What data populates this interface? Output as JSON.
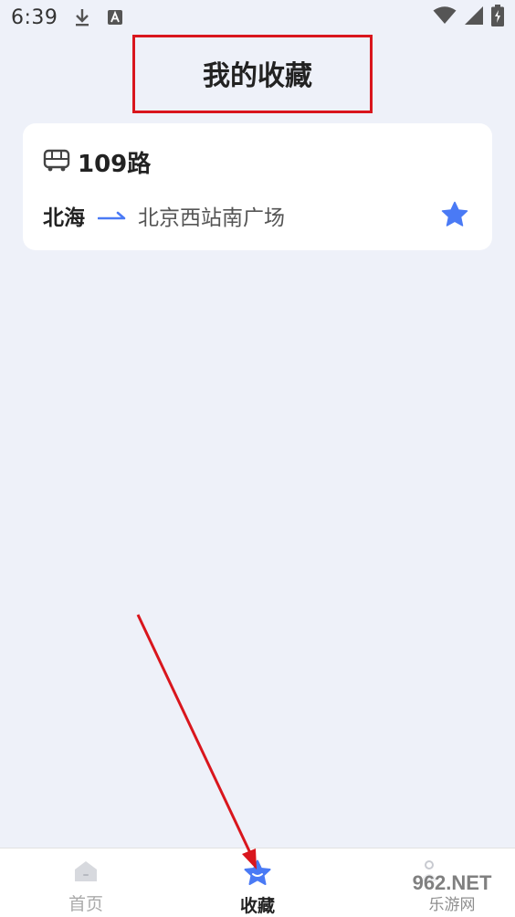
{
  "status_bar": {
    "time": "6:39"
  },
  "header": {
    "title": "我的收藏"
  },
  "favorites": [
    {
      "route": "109路",
      "from": "北海",
      "to": "北京西站南广场"
    }
  ],
  "bottom_nav": {
    "home_label": "首页",
    "favorites_label": "收藏"
  },
  "colors": {
    "accent": "#4a7af5",
    "background": "#eef1f9",
    "annotation": "#d9161d"
  },
  "watermark": {
    "text_top": "962.NET",
    "text_bottom": "乐游网"
  }
}
